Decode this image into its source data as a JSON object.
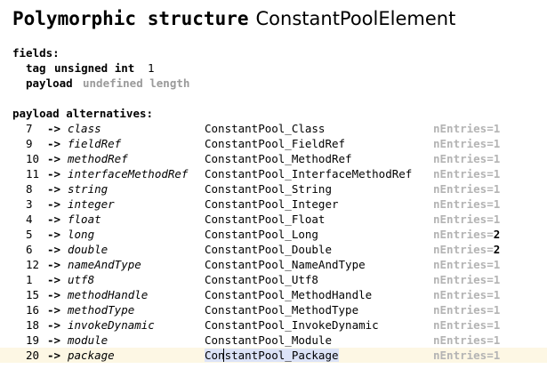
{
  "header": {
    "keyword": "Polymorphic structure",
    "name": "ConstantPoolElement"
  },
  "fields_label": "fields:",
  "fields": [
    {
      "name": "tag",
      "type": "unsigned int",
      "value": "1"
    },
    {
      "name": "payload",
      "type": "undefined length",
      "value": ""
    }
  ],
  "alternatives_label": "payload alternatives:",
  "arrow": "->",
  "alternatives": [
    {
      "tag": "7",
      "name": "class",
      "type": "ConstantPool_Class",
      "entries_label": "nEntries=",
      "entries": "1"
    },
    {
      "tag": "9",
      "name": "fieldRef",
      "type": "ConstantPool_FieldRef",
      "entries_label": "nEntries=",
      "entries": "1"
    },
    {
      "tag": "10",
      "name": "methodRef",
      "type": "ConstantPool_MethodRef",
      "entries_label": "nEntries=",
      "entries": "1"
    },
    {
      "tag": "11",
      "name": "interfaceMethodRef",
      "type": "ConstantPool_InterfaceMethodRef",
      "entries_label": "nEntries=",
      "entries": "1"
    },
    {
      "tag": "8",
      "name": "string",
      "type": "ConstantPool_String",
      "entries_label": "nEntries=",
      "entries": "1"
    },
    {
      "tag": "3",
      "name": "integer",
      "type": "ConstantPool_Integer",
      "entries_label": "nEntries=",
      "entries": "1"
    },
    {
      "tag": "4",
      "name": "float",
      "type": "ConstantPool_Float",
      "entries_label": "nEntries=",
      "entries": "1"
    },
    {
      "tag": "5",
      "name": "long",
      "type": "ConstantPool_Long",
      "entries_label": "nEntries=",
      "entries": "2"
    },
    {
      "tag": "6",
      "name": "double",
      "type": "ConstantPool_Double",
      "entries_label": "nEntries=",
      "entries": "2"
    },
    {
      "tag": "12",
      "name": "nameAndType",
      "type": "ConstantPool_NameAndType",
      "entries_label": "nEntries=",
      "entries": "1"
    },
    {
      "tag": "1",
      "name": "utf8",
      "type": "ConstantPool_Utf8",
      "entries_label": "nEntries=",
      "entries": "1"
    },
    {
      "tag": "15",
      "name": "methodHandle",
      "type": "ConstantPool_MethodHandle",
      "entries_label": "nEntries=",
      "entries": "1"
    },
    {
      "tag": "16",
      "name": "methodType",
      "type": "ConstantPool_MethodType",
      "entries_label": "nEntries=",
      "entries": "1"
    },
    {
      "tag": "18",
      "name": "invokeDynamic",
      "type": "ConstantPool_InvokeDynamic",
      "entries_label": "nEntries=",
      "entries": "1"
    },
    {
      "tag": "19",
      "name": "module",
      "type": "ConstantPool_Module",
      "entries_label": "nEntries=",
      "entries": "1"
    },
    {
      "tag": "20",
      "name": "package",
      "type": "ConstantPool_Package",
      "entries_label": "nEntries=",
      "entries": "1"
    }
  ],
  "colors": {
    "current_line": "#fdf7e4",
    "selection": "#dce3f7",
    "dim_text": "#b4b4b4"
  }
}
